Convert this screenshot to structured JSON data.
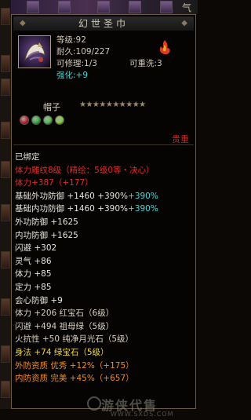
{
  "top_strip": {
    "tab_label": "气"
  },
  "item": {
    "name": "幻世圣巾",
    "level_label": "等级",
    "level_value": ":92",
    "durability_label": "耐久",
    "durability_value": ":109/227",
    "repair_label": "可修理",
    "repair_value": ":1/3",
    "rewash_label": "可重洗",
    "rewash_value": ":3",
    "enhance_label": "强化",
    "enhance_value": ":+9",
    "category": "帽子",
    "stars_filled": 10,
    "star_glyphs": "★★★★★★★★★★",
    "tier": "贵重"
  },
  "sockets": [
    {
      "color": "#c02030"
    },
    {
      "color": "#30b040"
    },
    {
      "color": "#50c050"
    },
    {
      "color": "#80d040"
    }
  ],
  "attributes": [
    {
      "text": "已绑定",
      "color": "white"
    },
    {
      "text": "体力雕纹8级（精绘：5级0等・决心）",
      "color": "red"
    },
    {
      "text": "体力+387（+177）",
      "color": "red"
    },
    {
      "text": "基础外功防御 +1460 +390%",
      "color": "white",
      "extra": "+390%"
    },
    {
      "text": "基础内功防御 +1460 +390%",
      "color": "white",
      "extra": "+390%"
    },
    {
      "text": "外功防御 +1625",
      "color": "white"
    },
    {
      "text": "内功防御 +1625",
      "color": "white"
    },
    {
      "text": "闪避 +302",
      "color": "white"
    },
    {
      "text": "灵气 +86",
      "color": "white"
    },
    {
      "text": "体力 +85",
      "color": "white"
    },
    {
      "text": "定力 +85",
      "color": "white"
    },
    {
      "text": "会心防御 +9",
      "color": "white"
    },
    {
      "text": "体力 +206 红宝石（6级）",
      "color": "stone"
    },
    {
      "text": "闪避 +494 祖母绿（5级）",
      "color": "stone"
    },
    {
      "text": "火抗性 +50 纯净月光石（5级）",
      "color": "stone"
    },
    {
      "text": "身法 +74 绿宝石（5级）",
      "color": "yellow"
    },
    {
      "text": "外防资质 优秀 +12%（+175）",
      "color": "orange"
    },
    {
      "text": "内防资质 完美 +45%（+657）",
      "color": "orange"
    }
  ],
  "watermark": {
    "main": "游侠代售",
    "sub": "WWW.SXDS.COM"
  }
}
